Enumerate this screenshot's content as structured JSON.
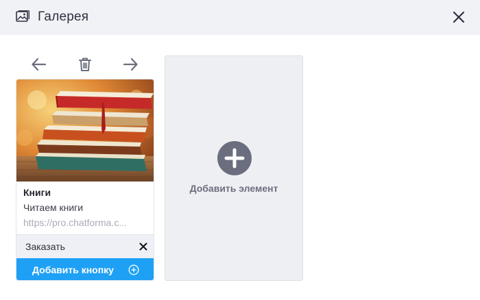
{
  "header": {
    "title": "Галерея",
    "icon": "gallery-image-icon",
    "close_icon": "close-icon"
  },
  "toolbar": {
    "prev_icon": "arrow-left-icon",
    "delete_icon": "trash-icon",
    "next_icon": "arrow-right-icon"
  },
  "card": {
    "image": "books-stack-image",
    "title": "Книги",
    "subtitle": "Читаем книги",
    "url": "https://pro.chatforma.c...",
    "buttons": [
      {
        "label": "Заказать"
      }
    ],
    "add_button_label": "Добавить кнопку"
  },
  "add_element": {
    "label": "Добавить элемент"
  },
  "colors": {
    "header_bg": "#f1f2f6",
    "accent": "#1ea0f5",
    "placeholder_bg": "#eeeff3",
    "icon_gray": "#6b6e7e"
  }
}
